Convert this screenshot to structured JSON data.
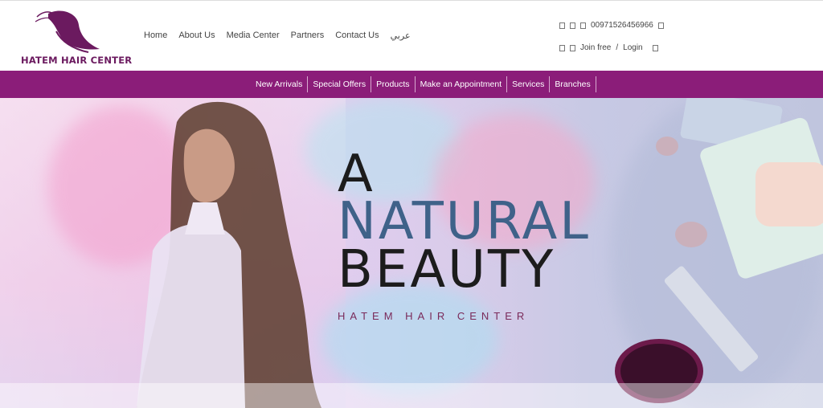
{
  "brand": {
    "name": "HATEM HAIR CENTER",
    "color": "#6b1a5f"
  },
  "top_nav": [
    {
      "label": "Home"
    },
    {
      "label": "About Us"
    },
    {
      "label": "Media Center"
    },
    {
      "label": "Partners"
    },
    {
      "label": "Contact Us"
    },
    {
      "label": "عربي"
    }
  ],
  "contact": {
    "phone": "00971526456966"
  },
  "account": {
    "join": "Join free",
    "separator": "/",
    "login": "Login"
  },
  "main_nav": {
    "background": "#8b1d79",
    "items": [
      {
        "label": "New Arrivals"
      },
      {
        "label": "Special Offers"
      },
      {
        "label": "Products"
      },
      {
        "label": "Make an Appointment"
      },
      {
        "label": "Services"
      },
      {
        "label": "Branches"
      }
    ]
  },
  "hero": {
    "line1": "A",
    "line2": "NATURAL",
    "line3": "BEAUTY",
    "subtitle": "HATEM HAIR CENTER"
  }
}
